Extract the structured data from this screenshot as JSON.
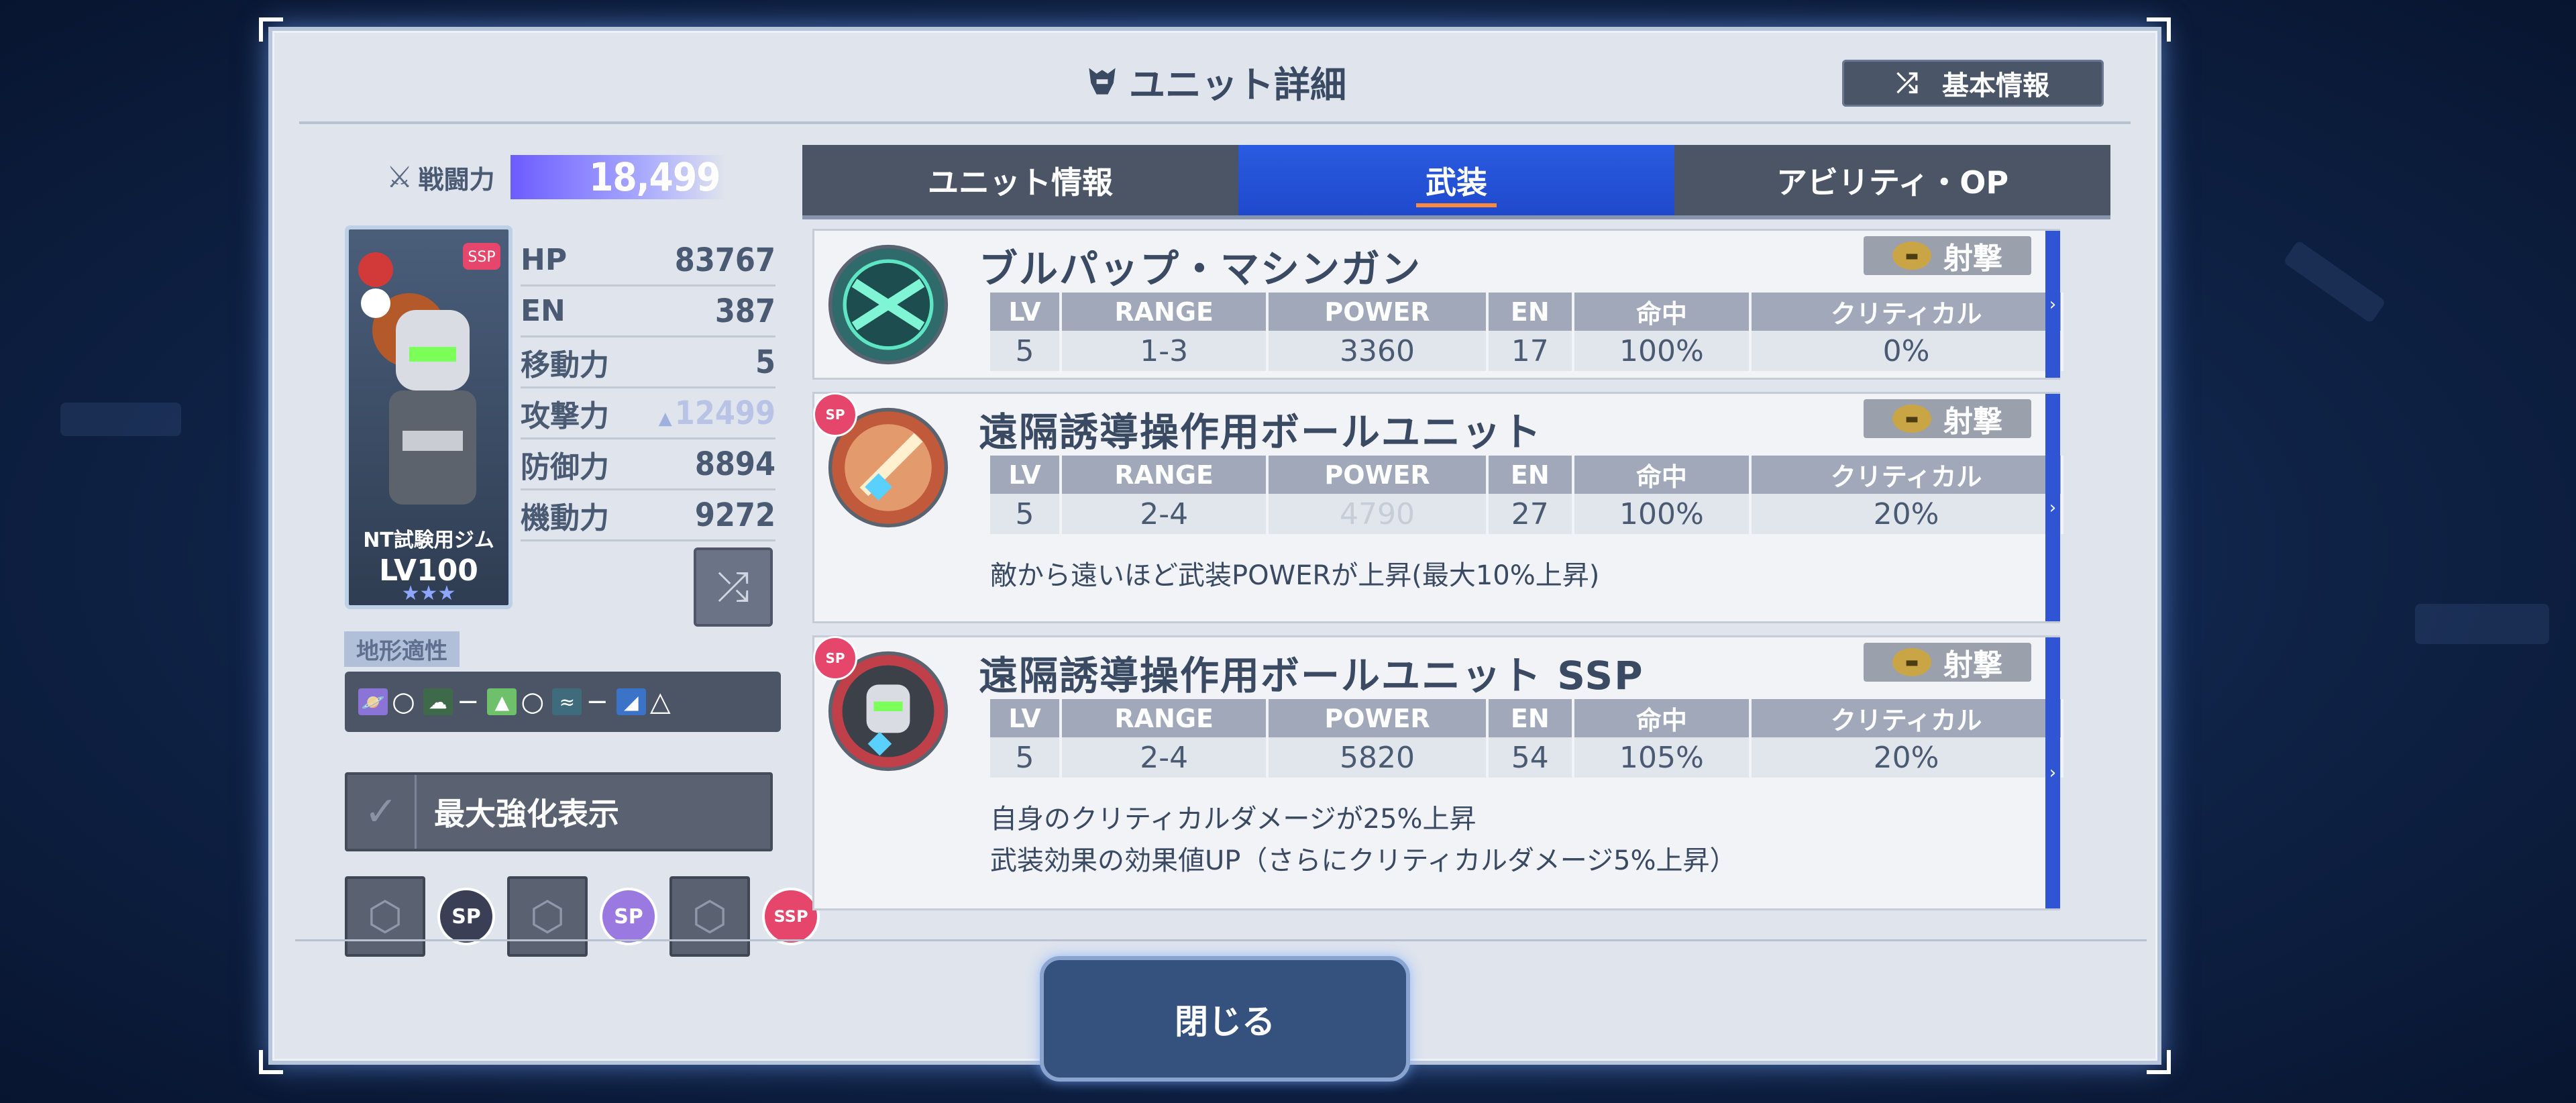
{
  "header": {
    "title": "ユニット詳細",
    "basic_info_label": "基本情報"
  },
  "combat": {
    "label": "戦闘力",
    "value": "18,499"
  },
  "unit": {
    "name": "NT試験用ジム",
    "level": "LV100",
    "stars": "★★★",
    "stats": [
      {
        "label": "HP",
        "value": "83767",
        "faded": false,
        "arrow": false
      },
      {
        "label": "EN",
        "value": "387",
        "faded": false,
        "arrow": false
      },
      {
        "label": "移動力",
        "value": "5",
        "faded": false,
        "arrow": false
      },
      {
        "label": "攻撃力",
        "value": "12499",
        "faded": true,
        "arrow": true
      },
      {
        "label": "防御力",
        "value": "8894",
        "faded": false,
        "arrow": false
      },
      {
        "label": "機動力",
        "value": "9272",
        "faded": false,
        "arrow": false
      }
    ]
  },
  "terrain": {
    "label": "地形適性",
    "items": [
      {
        "icon": "space-icon",
        "value": "○"
      },
      {
        "icon": "land-icon",
        "value": "−"
      },
      {
        "icon": "mountain-icon",
        "value": "○"
      },
      {
        "icon": "water-icon",
        "value": "−"
      },
      {
        "icon": "underwater-icon",
        "value": "△"
      }
    ]
  },
  "max_enhance": {
    "label": "最大強化表示"
  },
  "slots": {
    "badges": [
      "SP",
      "SP",
      "SSP"
    ]
  },
  "tabs": [
    {
      "label": "ユニット情報"
    },
    {
      "label": "武装"
    },
    {
      "label": "アビリティ・OP"
    }
  ],
  "table_headers": [
    "LV",
    "RANGE",
    "POWER",
    "EN",
    "命中",
    "クリティカル"
  ],
  "weapons": [
    {
      "name": "ブルパップ・マシンガン",
      "type": "射撃",
      "row": [
        "5",
        "1-3",
        "3360",
        "17",
        "100%",
        "0%"
      ],
      "faded_power": false,
      "desc": []
    },
    {
      "name": "遠隔誘導操作用ボールユニット",
      "type": "射撃",
      "row": [
        "5",
        "2-4",
        "4790",
        "27",
        "100%",
        "20%"
      ],
      "faded_power": true,
      "desc": [
        "敵から遠いほど武装POWERが上昇(最大10%上昇)"
      ]
    },
    {
      "name": "遠隔誘導操作用ボールユニット SSP",
      "type": "射撃",
      "row": [
        "5",
        "2-4",
        "5820",
        "54",
        "105%",
        "20%"
      ],
      "faded_power": false,
      "desc": [
        "自身のクリティカルダメージが25%上昇",
        "武装効果の効果値UP（さらにクリティカルダメージ5%上昇）"
      ]
    }
  ],
  "footer": {
    "close_label": "閉じる"
  },
  "colors": {
    "accent": "#2a5be0",
    "frame": "#dfe4ed",
    "type_badge": "#c9a545"
  }
}
